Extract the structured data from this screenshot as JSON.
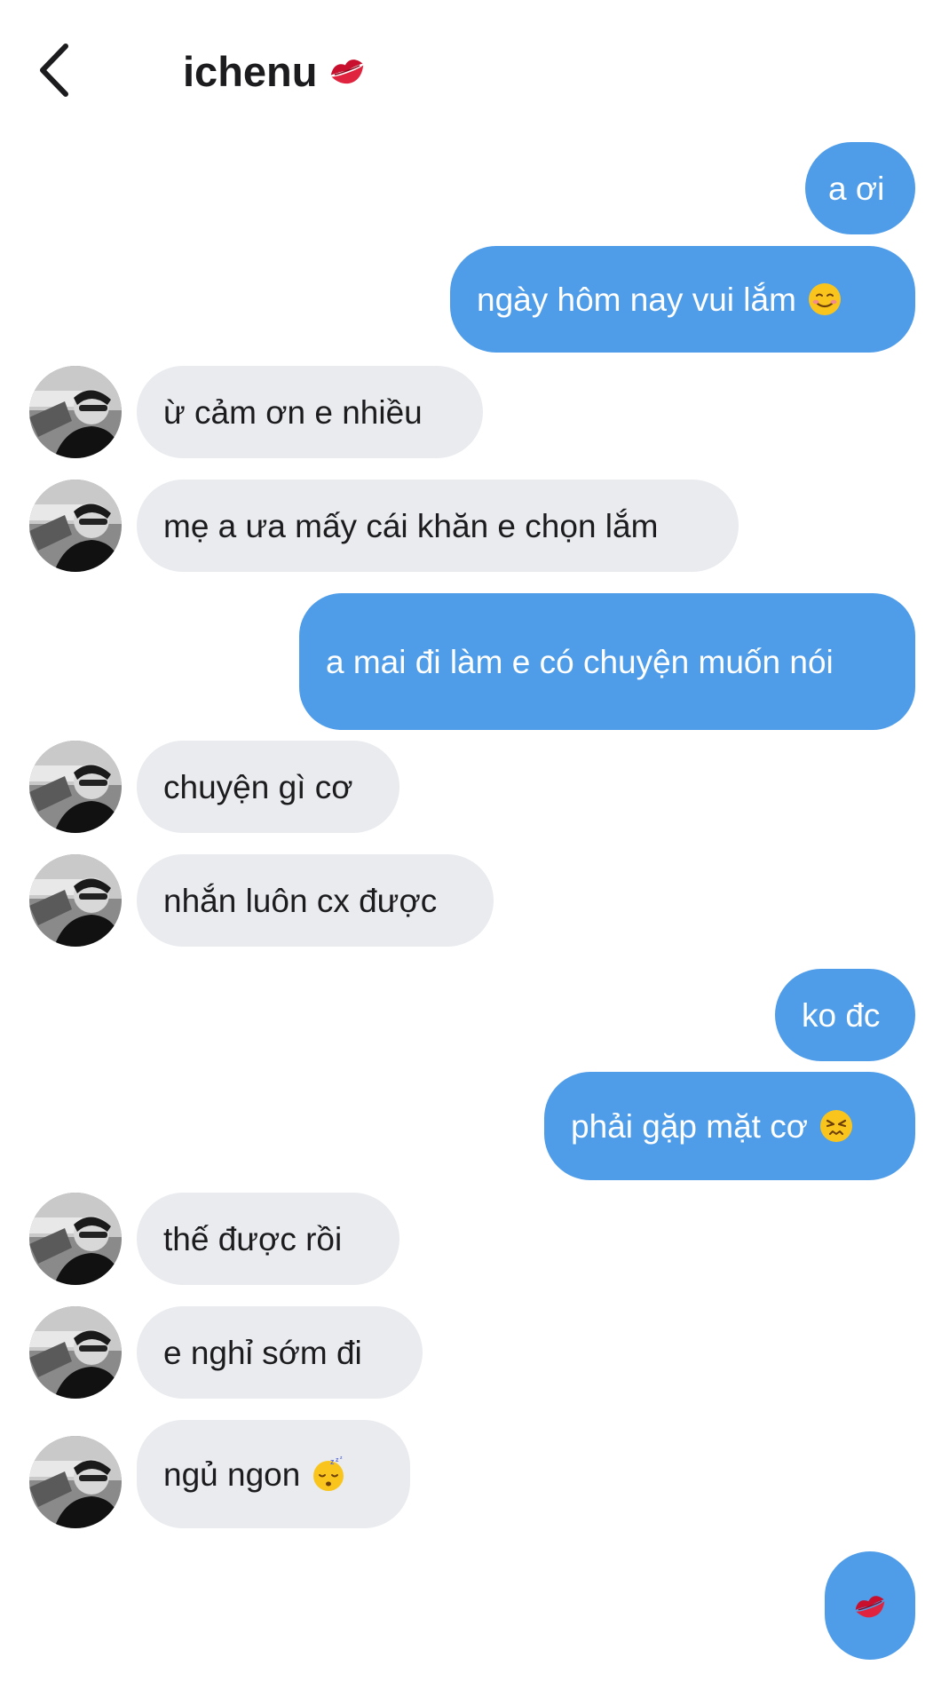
{
  "header": {
    "title": "ichenu",
    "title_emoji": "kiss-mark-icon"
  },
  "messages": [
    {
      "side": "out",
      "text": "a ơi"
    },
    {
      "side": "out",
      "text": "ngày hôm nay vui lắm",
      "emoji": "smiling-face-icon"
    },
    {
      "side": "in",
      "text": "ừ cảm ơn e nhiều"
    },
    {
      "side": "in",
      "text": "mẹ a ưa mấy cái khăn e chọn lắm"
    },
    {
      "side": "out",
      "text": "a mai đi làm e có chuyện muốn nói"
    },
    {
      "side": "in",
      "text": "chuyện gì cơ"
    },
    {
      "side": "in",
      "text": "nhắn luôn cx được"
    },
    {
      "side": "out",
      "text": "ko đc"
    },
    {
      "side": "out",
      "text": "phải gặp mặt cơ",
      "emoji": "persevering-face-icon"
    },
    {
      "side": "in",
      "text": "thế được rồi"
    },
    {
      "side": "in",
      "text": "e nghỉ sớm đi"
    },
    {
      "side": "in",
      "text": "ngủ ngon",
      "emoji": "sleeping-face-icon"
    },
    {
      "side": "out",
      "text": "",
      "emoji": "kiss-mark-icon"
    }
  ],
  "colors": {
    "outgoing_bubble": "#4f9de9",
    "incoming_bubble": "#e9ebef",
    "text_dark": "#1c1c1e"
  }
}
